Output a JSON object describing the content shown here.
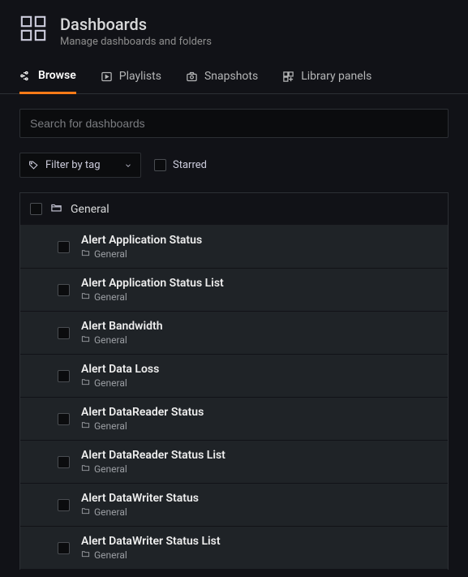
{
  "header": {
    "title": "Dashboards",
    "subtitle": "Manage dashboards and folders"
  },
  "tabs": [
    {
      "label": "Browse",
      "active": true
    },
    {
      "label": "Playlists",
      "active": false
    },
    {
      "label": "Snapshots",
      "active": false
    },
    {
      "label": "Library panels",
      "active": false
    }
  ],
  "search": {
    "placeholder": "Search for dashboards"
  },
  "filters": {
    "tag_label": "Filter by tag",
    "starred_label": "Starred"
  },
  "folder": {
    "name": "General"
  },
  "items": [
    {
      "title": "Alert Application Status",
      "folder": "General"
    },
    {
      "title": "Alert Application Status List",
      "folder": "General"
    },
    {
      "title": "Alert Bandwidth",
      "folder": "General"
    },
    {
      "title": "Alert Data Loss",
      "folder": "General"
    },
    {
      "title": "Alert DataReader Status",
      "folder": "General"
    },
    {
      "title": "Alert DataReader Status List",
      "folder": "General"
    },
    {
      "title": "Alert DataWriter Status",
      "folder": "General"
    },
    {
      "title": "Alert DataWriter Status List",
      "folder": "General"
    }
  ]
}
